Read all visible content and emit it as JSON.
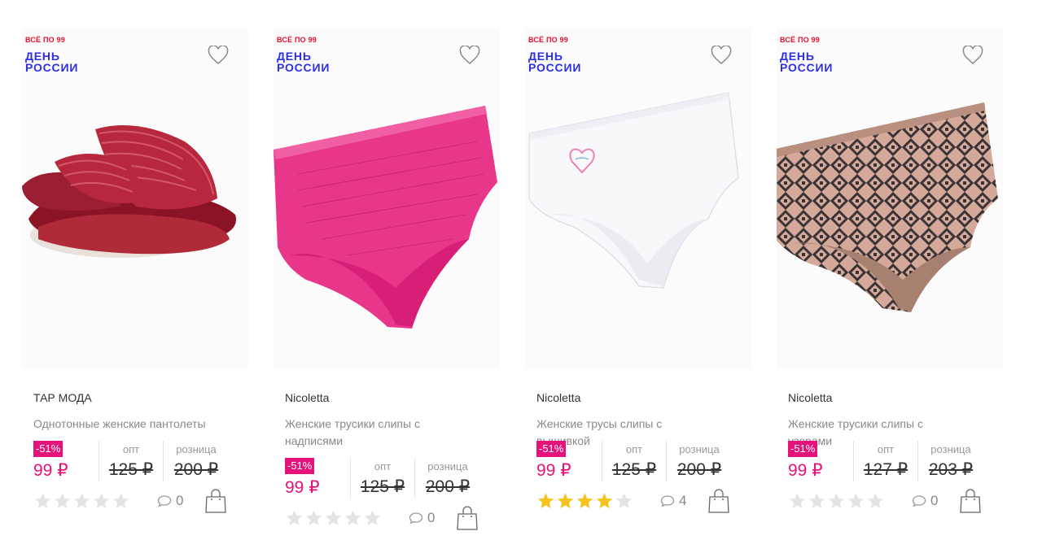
{
  "products": [
    {
      "promo_small": "ВСЁ ПО 99",
      "promo_big": "ДЕНЬ\nРОССИИ",
      "brand": "ТАР МОДА",
      "title": "Однотонные женские пантолеты",
      "discount": "-51%",
      "sale_price": "99 ₽",
      "opt_label": "опт",
      "opt_price": "125 ₽",
      "retail_label": "розница",
      "retail_price": "200 ₽",
      "rating": 0,
      "comments": "0"
    },
    {
      "promo_small": "ВСЁ ПО 99",
      "promo_big": "ДЕНЬ\nРОССИИ",
      "brand": "Nicoletta",
      "title": "Женские трусики слипы с надписями",
      "discount": "-51%",
      "sale_price": "99 ₽",
      "opt_label": "опт",
      "opt_price": "125 ₽",
      "retail_label": "розница",
      "retail_price": "200 ₽",
      "rating": 0,
      "comments": "0"
    },
    {
      "promo_small": "ВСЁ ПО 99",
      "promo_big": "ДЕНЬ\nРОССИИ",
      "brand": "Nicoletta",
      "title": "Женские трусы слипы с вышивкой",
      "discount": "-51%",
      "sale_price": "99 ₽",
      "opt_label": "опт",
      "opt_price": "125 ₽",
      "retail_label": "розница",
      "retail_price": "200 ₽",
      "rating": 4,
      "comments": "4"
    },
    {
      "promo_small": "ВСЁ ПО 99",
      "promo_big": "ДЕНЬ\nРОССИИ",
      "brand": "Nicoletta",
      "title": "Женские трусики слипы с узорами",
      "discount": "-51%",
      "sale_price": "99 ₽",
      "opt_label": "опт",
      "opt_price": "127 ₽",
      "retail_label": "розница",
      "retail_price": "203 ₽",
      "rating": 0,
      "comments": "0"
    }
  ],
  "colors": {
    "accent": "#e5127b",
    "promo_red": "#e8102e",
    "promo_blue": "#2d2fe0",
    "star_on": "#f7c21e",
    "star_off": "#e4e4e4"
  },
  "icons": {
    "favorite": "heart-outline-icon",
    "comments": "speech-bubble-icon",
    "cart": "shopping-bag-icon",
    "rating": "star-icon"
  }
}
